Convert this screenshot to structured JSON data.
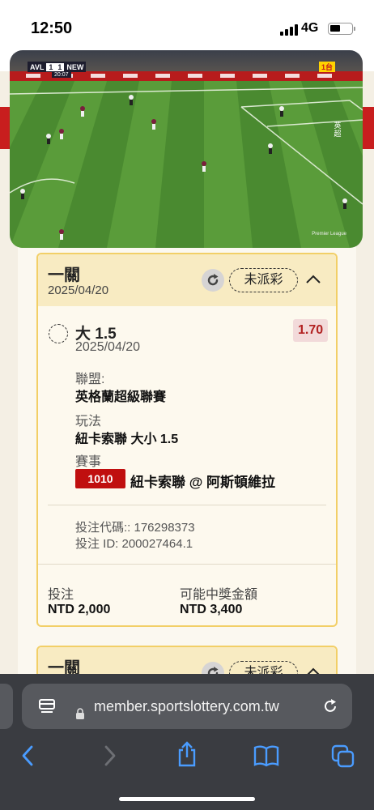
{
  "status_bar": {
    "time": "12:50",
    "network": "4G"
  },
  "video": {
    "home_team": "AVL",
    "home_score": "1",
    "away_score": "1",
    "away_team": "NEW",
    "match_clock": "20:07",
    "channel_badge": "1台",
    "vertical_caption": "英超",
    "corner_label": "Premier League"
  },
  "bets": [
    {
      "title": "一關",
      "date": "2025/04/20",
      "status": "未派彩",
      "selection": {
        "name": "大 1.5",
        "date": "2025/04/20",
        "odds": "1.70",
        "league_label": "聯盟:",
        "league_value": "英格蘭超級聯賽",
        "market_label": "玩法",
        "market_value": "紐卡索聯 大小 1.5",
        "event_label": "賽事",
        "event_id": "1010",
        "event_name": "紐卡索聯 @ 阿斯頓維拉",
        "bet_code": "投注代碼:: 176298373",
        "bet_id": "投注 ID: 200027464.1"
      },
      "stake_label": "投注",
      "stake_value": "NTD 2,000",
      "payout_label": "可能中獎金額",
      "payout_value": "NTD 3,400"
    },
    {
      "title": "一關",
      "status": "未派彩"
    }
  ],
  "safari": {
    "url": "member.sportslottery.com.tw",
    "icons": [
      "tab-overview-icon",
      "lock-icon",
      "reload-icon",
      "back-icon",
      "forward-icon",
      "share-icon",
      "bookmarks-icon",
      "tabs-icon"
    ]
  },
  "colors": {
    "accent_red": "#c81e1e",
    "card_border": "#f2cf67",
    "odds_text": "#b22222"
  }
}
